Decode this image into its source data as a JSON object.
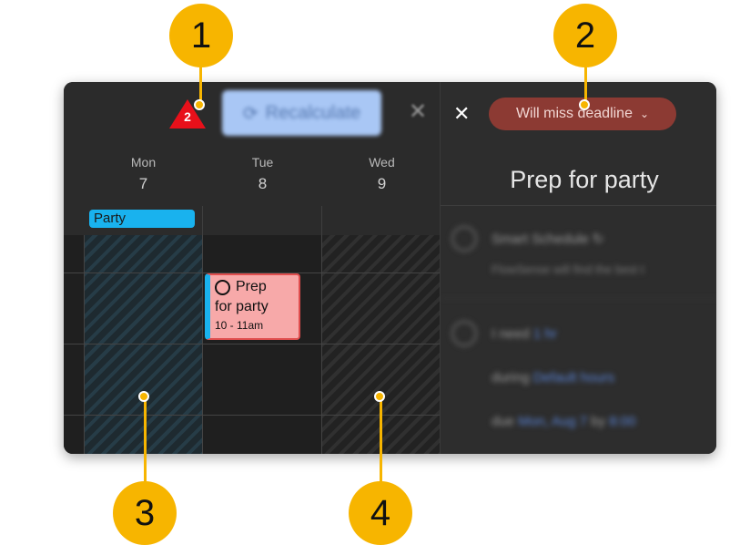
{
  "calendar": {
    "warning_count": "2",
    "recalculate_label": "Recalculate",
    "close_label": "✕",
    "days": [
      {
        "name": "Mon",
        "num": "7"
      },
      {
        "name": "Tue",
        "num": "8"
      },
      {
        "name": "Wed",
        "num": "9"
      }
    ],
    "allday_event": "Party",
    "event": {
      "title_line1": "Prep",
      "title_line2": "for party",
      "time": "10 - 11am"
    }
  },
  "panel": {
    "close_label": "✕",
    "status_label": "Will miss deadline",
    "status_chevron": "⌄",
    "task_title": "Prep for party",
    "smart_schedule": "Smart Schedule ↻",
    "smart_sub": "FlowSense will find the best t",
    "need_label": "I need",
    "need_value": "1 hr",
    "during_label": "during",
    "during_value": "Default hours",
    "due_label": "due",
    "due_value": "Mon, Aug 7",
    "by_label": "by",
    "by_value": "8:00"
  },
  "callouts": [
    "1",
    "2",
    "3",
    "4"
  ],
  "colors": {
    "accent_blue": "#19b2ee",
    "warning_red": "#e8101a",
    "deadline_pill": "#8c3a33",
    "callout": "#f7b500",
    "event_fill": "#f7a9a9"
  }
}
